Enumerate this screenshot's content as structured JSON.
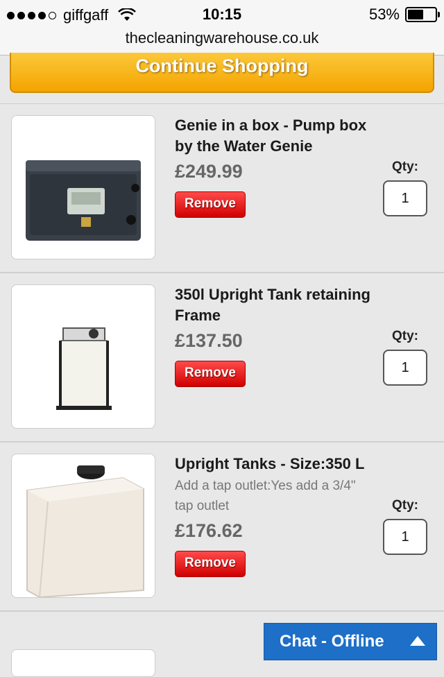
{
  "status_bar": {
    "carrier": "giffgaff",
    "time": "10:15",
    "battery_percent": "53%",
    "battery_level": 0.53,
    "signal_bars_filled": 4,
    "signal_bars_total": 5
  },
  "browser": {
    "url": "thecleaningwarehouse.co.uk"
  },
  "cart": {
    "continue_label": "Continue Shopping",
    "qty_label": "Qty:",
    "remove_label": "Remove",
    "items": [
      {
        "name": "Genie in a box - Pump box by the Water Genie",
        "option": "",
        "price": "£249.99",
        "qty": "1"
      },
      {
        "name": "350l Upright Tank retaining Frame",
        "option": "",
        "price": "£137.50",
        "qty": "1"
      },
      {
        "name": "Upright Tanks - Size:350 L",
        "option": "Add a tap outlet:Yes add a 3/4\" tap outlet",
        "price": "£176.62",
        "qty": "1"
      }
    ]
  },
  "chat": {
    "label": "Chat - Offline",
    "icon": "chevron-up-icon"
  },
  "colors": {
    "continue_button": "#f4a400",
    "remove_button": "#e00000",
    "chat_bar": "#1d6fc8",
    "background": "#e8e8e8"
  }
}
